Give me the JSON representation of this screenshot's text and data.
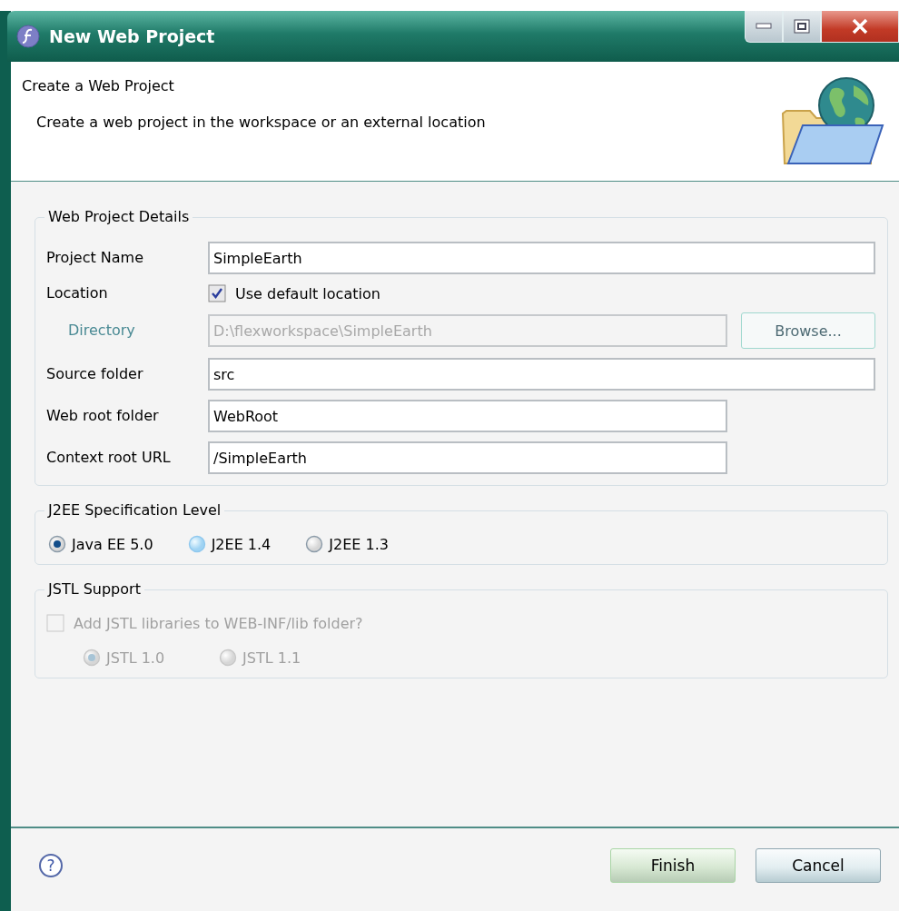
{
  "window": {
    "title": "New Web Project"
  },
  "header": {
    "title": "Create a Web Project",
    "description": "Create a web project in the workspace or an external location"
  },
  "details": {
    "legend": "Web Project Details",
    "rows": [
      {
        "kind": "wide-text",
        "label": "Project Name",
        "value": "SimpleEarth",
        "disabled": false
      },
      {
        "kind": "checkbox",
        "label": "Location",
        "option": "Use default location",
        "checked": true,
        "disabled": false
      },
      {
        "kind": "browse",
        "label": "Directory",
        "value": "D:\\flexworkspace\\SimpleEarth",
        "button": "Browse...",
        "disabled": true
      },
      {
        "kind": "wide-text",
        "label": "Source folder",
        "value": "src",
        "disabled": false
      },
      {
        "kind": "text",
        "label": "Web root folder",
        "value": "WebRoot",
        "disabled": false
      },
      {
        "kind": "text",
        "label": "Context root URL",
        "value": "/SimpleEarth",
        "disabled": false
      }
    ]
  },
  "j2ee": {
    "legend": "J2EE Specification Level",
    "options": [
      {
        "label": "Java EE 5.0",
        "selected": true,
        "hovered": false
      },
      {
        "label": "J2EE 1.4",
        "selected": false,
        "hovered": true
      },
      {
        "label": "J2EE 1.3",
        "selected": false,
        "hovered": false
      }
    ]
  },
  "jstl": {
    "legend": "JSTL Support",
    "checkbox": {
      "label": "Add JSTL libraries to WEB-INF/lib folder?",
      "checked": false,
      "disabled": true
    },
    "options": [
      {
        "label": "JSTL 1.0",
        "selected": true,
        "disabled": true
      },
      {
        "label": "JSTL 1.1",
        "selected": false,
        "disabled": true
      }
    ]
  },
  "footer": {
    "help": "?",
    "buttons": [
      {
        "label": "Finish",
        "default": true
      },
      {
        "label": "Cancel",
        "default": false
      }
    ]
  }
}
